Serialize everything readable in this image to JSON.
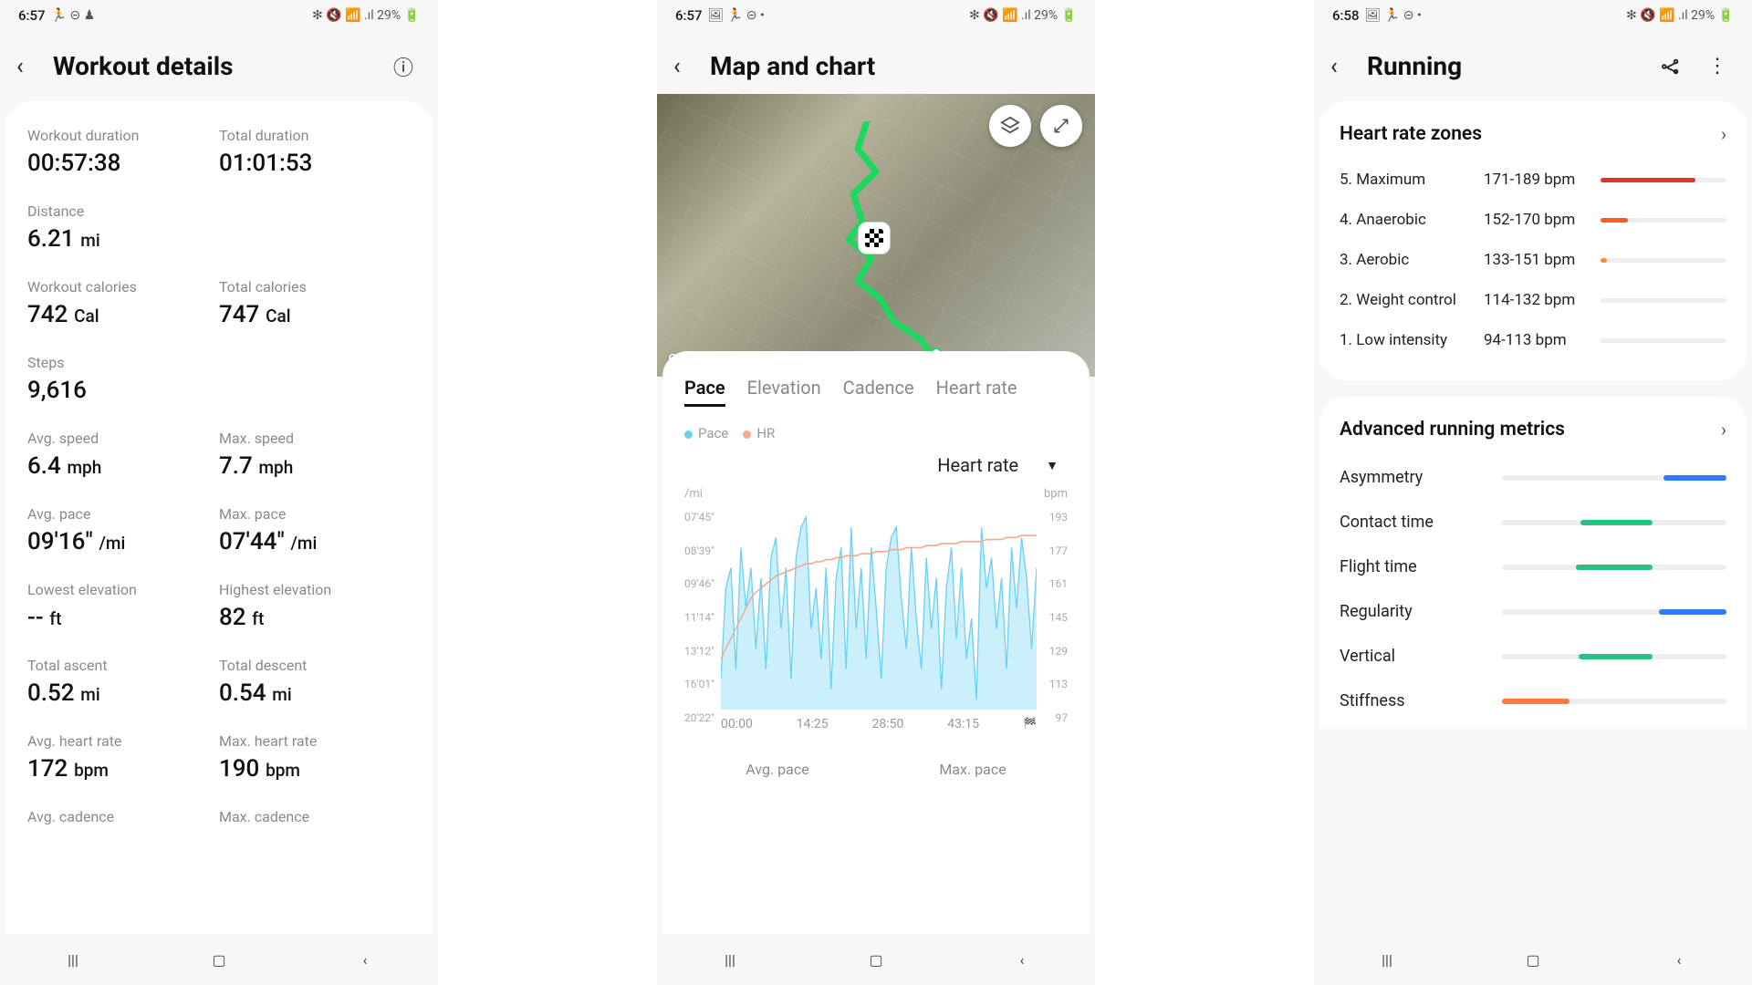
{
  "status": {
    "screen1": {
      "time": "6:57",
      "icons_left": "🏃 ⊝ ♟",
      "icons_right": "✻ 🔇 📶 .ıl 29% 🔋"
    },
    "screen2": {
      "time": "6:57",
      "icons_left": "🖼 🏃 ⊝ •",
      "icons_right": "✻ 🔇 📶 .ıl 29% 🔋"
    },
    "screen3": {
      "time": "6:58",
      "icons_left": "🖼 🏃 ⊝ •",
      "icons_right": "✻ 🔇 📶 .ıl 29% 🔋"
    }
  },
  "screen1": {
    "title": "Workout details",
    "metrics": [
      [
        {
          "label": "Workout duration",
          "value": "00:57:38",
          "unit": ""
        },
        {
          "label": "Total duration",
          "value": "01:01:53",
          "unit": ""
        }
      ],
      [
        {
          "label": "Distance",
          "value": "6.21",
          "unit": " mi"
        },
        null
      ],
      [
        {
          "label": "Workout calories",
          "value": "742",
          "unit": " Cal"
        },
        {
          "label": "Total calories",
          "value": "747",
          "unit": " Cal"
        }
      ],
      [
        {
          "label": "Steps",
          "value": "9,616",
          "unit": ""
        },
        null
      ],
      [
        {
          "label": "Avg. speed",
          "value": "6.4",
          "unit": " mph"
        },
        {
          "label": "Max. speed",
          "value": "7.7",
          "unit": " mph"
        }
      ],
      [
        {
          "label": "Avg. pace",
          "value": "09'16\"",
          "unit": " /mi"
        },
        {
          "label": "Max. pace",
          "value": "07'44\"",
          "unit": " /mi"
        }
      ],
      [
        {
          "label": "Lowest elevation",
          "value": "--",
          "unit": " ft"
        },
        {
          "label": "Highest elevation",
          "value": "82",
          "unit": " ft"
        }
      ],
      [
        {
          "label": "Total ascent",
          "value": "0.52",
          "unit": " mi"
        },
        {
          "label": "Total descent",
          "value": "0.54",
          "unit": " mi"
        }
      ],
      [
        {
          "label": "Avg. heart rate",
          "value": "172",
          "unit": " bpm"
        },
        {
          "label": "Max. heart rate",
          "value": "190",
          "unit": " bpm"
        }
      ],
      [
        {
          "label": "Avg. cadence",
          "value": "",
          "unit": ""
        },
        {
          "label": "Max. cadence",
          "value": "",
          "unit": ""
        }
      ]
    ]
  },
  "screen2": {
    "title": "Map and chart",
    "google": "Google",
    "tabs": [
      "Pace",
      "Elevation",
      "Cadence",
      "Heart rate"
    ],
    "active_tab": 0,
    "legend": {
      "pace": "Pace",
      "hr": "HR"
    },
    "dropdown": "Heart rate",
    "y_unit_left": "/mi",
    "y_unit_right": "bpm",
    "stat_labels": {
      "avg": "Avg. pace",
      "max": "Max. pace"
    }
  },
  "chart_data": {
    "type": "line",
    "x_times": [
      "00:00",
      "14:25",
      "28:50",
      "43:15"
    ],
    "left_axis": {
      "unit": "/mi",
      "ticks": [
        "07'45\"",
        "08'39\"",
        "09'46\"",
        "11'14\"",
        "13'12\"",
        "16'01\"",
        "20'22\""
      ]
    },
    "right_axis": {
      "unit": "bpm",
      "ticks": [
        193,
        177,
        161,
        145,
        129,
        113,
        97
      ]
    },
    "series": [
      {
        "name": "Pace",
        "color": "#6ad1f3",
        "y_values": [
          0.85,
          0.4,
          0.3,
          0.8,
          0.2,
          0.5,
          0.3,
          0.7,
          0.35,
          0.8,
          0.25,
          0.15,
          0.6,
          0.3,
          0.85,
          0.25,
          0.1,
          0.05,
          0.6,
          0.4,
          0.75,
          0.3,
          0.9,
          0.35,
          0.2,
          0.8,
          0.1,
          0.6,
          0.3,
          0.75,
          0.2,
          0.5,
          0.85,
          0.3,
          0.15,
          0.1,
          0.45,
          0.7,
          0.2,
          0.55,
          0.8,
          0.25,
          0.6,
          0.35,
          0.9,
          0.4,
          0.2,
          0.65,
          0.3,
          0.75,
          0.55,
          0.95,
          0.1,
          0.4,
          0.25,
          0.6,
          0.35,
          0.8,
          0.2,
          0.5,
          0.15,
          0.35,
          0.7,
          0.3
        ]
      },
      {
        "name": "HR",
        "color": "#f7a98c",
        "y_values": [
          0.75,
          0.7,
          0.65,
          0.6,
          0.55,
          0.5,
          0.45,
          0.42,
          0.4,
          0.38,
          0.36,
          0.34,
          0.33,
          0.32,
          0.31,
          0.3,
          0.29,
          0.28,
          0.28,
          0.27,
          0.27,
          0.26,
          0.26,
          0.25,
          0.25,
          0.24,
          0.24,
          0.24,
          0.23,
          0.23,
          0.23,
          0.22,
          0.22,
          0.22,
          0.21,
          0.21,
          0.21,
          0.2,
          0.2,
          0.2,
          0.2,
          0.19,
          0.19,
          0.19,
          0.18,
          0.18,
          0.18,
          0.18,
          0.17,
          0.17,
          0.17,
          0.17,
          0.17,
          0.16,
          0.16,
          0.16,
          0.16,
          0.15,
          0.15,
          0.15,
          0.14,
          0.14,
          0.14,
          0.14
        ]
      }
    ]
  },
  "screen3": {
    "title": "Running",
    "hr_zones": {
      "title": "Heart rate zones",
      "rows": [
        {
          "name": "5. Maximum",
          "range": "171-189 bpm",
          "color": "#e2342c",
          "fill": 0.75
        },
        {
          "name": "4. Anaerobic",
          "range": "152-170 bpm",
          "color": "#ff5a1f",
          "fill": 0.22
        },
        {
          "name": "3. Aerobic",
          "range": "133-151 bpm",
          "color": "#ff8a3d",
          "fill": 0.05
        },
        {
          "name": "2. Weight control",
          "range": "114-132 bpm",
          "color": "#d0d0d0",
          "fill": 0
        },
        {
          "name": "1. Low intensity",
          "range": "94-113 bpm",
          "color": "#d0d0d0",
          "fill": 0
        }
      ]
    },
    "adv": {
      "title": "Advanced running metrics",
      "rows": [
        {
          "name": "Asymmetry",
          "color": "#2f7bff",
          "pos": 0.72,
          "len": 0.28
        },
        {
          "name": "Contact time",
          "color": "#26c281",
          "pos": 0.35,
          "len": 0.32
        },
        {
          "name": "Flight time",
          "color": "#26c281",
          "pos": 0.33,
          "len": 0.34
        },
        {
          "name": "Regularity",
          "color": "#2f7bff",
          "pos": 0.7,
          "len": 0.3
        },
        {
          "name": "Vertical",
          "color": "#26c281",
          "pos": 0.34,
          "len": 0.33
        },
        {
          "name": "Stiffness",
          "color": "#ff7a3d",
          "pos": 0.0,
          "len": 0.3
        }
      ]
    }
  }
}
